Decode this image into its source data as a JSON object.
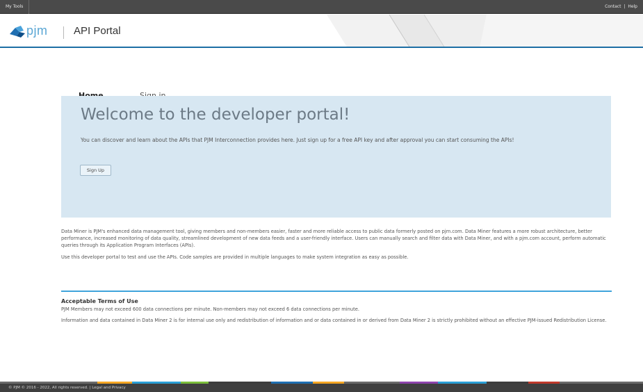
{
  "topbar": {
    "my_tools": "My Tools",
    "contact": "Contact",
    "separator": "|",
    "help": "Help"
  },
  "brand": {
    "logo_text": "pjm",
    "portal_title": "API Portal",
    "accent": "#1c6ea4"
  },
  "nav": {
    "home": "Home",
    "sign_in": "Sign in"
  },
  "hero": {
    "title": "Welcome to the developer portal!",
    "lead": "You can discover and learn about the APIs that PJM Interconnection provides here. Just sign up for a free API key and after approval you can start consuming the APIs!",
    "signup_label": "Sign Up",
    "background": "#d7e7f2"
  },
  "intro": {
    "paragraph_1": "Data Miner is PJM's enhanced data management tool, giving members and non-members easier, faster and more reliable access to public data formerly posted on pjm.com. Data Miner features a more robust architecture, better performance, increased monitoring of data quality, streamlined development of new data feeds and a user-friendly interface. Users can manually search and filter data with Data Miner, and with a pjm.com account, perform automatic queries through its Application Program Interfaces (APIs).",
    "paragraph_2": "Use this developer portal to test and use the APIs. Code samples are provided in multiple languages to make system integration as easy as possible."
  },
  "terms": {
    "heading": "Acceptable Terms of Use",
    "paragraph_1": "PJM Members may not exceed 600 data connections per minute. Non-members may not exceed 6 data connections per minute.",
    "paragraph_2": "Information and data contained in Data Miner 2 is for internal use only and redistribution of information and or data contained in or derived from Data Miner 2 is strictly prohibited without an effective PJM-issued Redistribution License."
  },
  "footer": {
    "copyright": "© PJM © 2016 - 2022, All rights reserved.  |  Legal and Privacy"
  }
}
